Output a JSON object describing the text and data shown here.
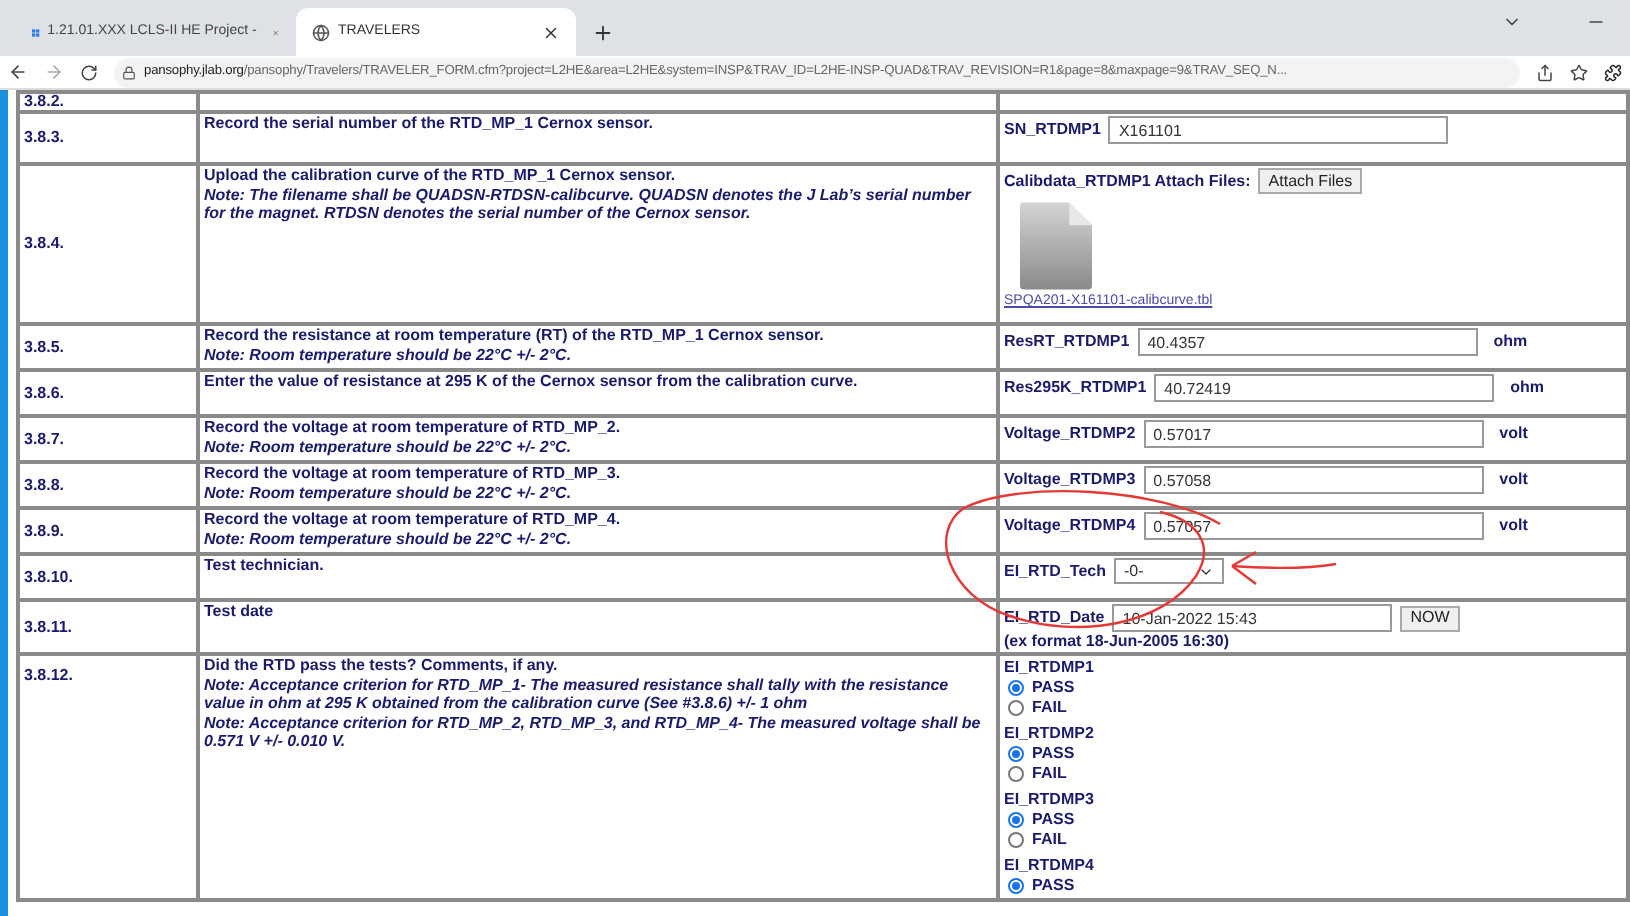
{
  "browser": {
    "tabs": [
      {
        "title": "1.21.01.XXX LCLS-II HE Project -",
        "selected": false
      },
      {
        "title": "TRAVELERS",
        "selected": true
      }
    ],
    "url": {
      "host": "pansophy.jlab.org",
      "path": "/pansophy/Travelers/TRAVELER_FORM.cfm?project=L2HE&area=L2HE&system=INSP&TRAV_ID=L2HE-INSP-QUAD&TRAV_REVISION=R1&page=8&maxpage=9&TRAV_SEQ_N..."
    }
  },
  "rows": [
    {
      "number": "3.8.2.",
      "instruction": [],
      "field": {
        "kind": "none"
      }
    },
    {
      "number": "3.8.3.",
      "instruction": [
        {
          "kind": "plain",
          "text": "Record the serial number of the RTD_MP_1 Cernox sensor."
        }
      ],
      "field": {
        "kind": "text",
        "label": "SN_RTDMP1",
        "value": "X161101"
      }
    },
    {
      "number": "3.8.4.",
      "instruction": [
        {
          "kind": "plain",
          "text": "Upload the calibration curve of the RTD_MP_1 Cernox sensor."
        },
        {
          "kind": "note",
          "text": "Note: The filename shall be QUADSN-RTDSN-calibcurve. QUADSN denotes the J Lab’s serial number for the magnet. RTDSN denotes the serial number of the Cernox sensor."
        }
      ],
      "field": {
        "kind": "attach",
        "label": "Calibdata_RTDMP1 Attach Files:",
        "button": "Attach Files",
        "filename": "SPQA201-X161101-calibcurve.tbl"
      }
    },
    {
      "number": "3.8.5.",
      "instruction": [
        {
          "kind": "plain",
          "text": "Record the resistance at room temperature (RT) of the RTD_MP_1 Cernox sensor."
        },
        {
          "kind": "note",
          "text": "Note: Room temperature should be 22°C +/- 2°C."
        }
      ],
      "field": {
        "kind": "text",
        "label": "ResRT_RTDMP1",
        "value": "40.4357",
        "unit": "ohm"
      }
    },
    {
      "number": "3.8.6.",
      "instruction": [
        {
          "kind": "plain",
          "text": "Enter the value of resistance at 295 K of the Cernox sensor from the calibration curve."
        }
      ],
      "field": {
        "kind": "text",
        "label": "Res295K_RTDMP1",
        "value": "40.72419",
        "unit": "ohm"
      }
    },
    {
      "number": "3.8.7.",
      "instruction": [
        {
          "kind": "plain",
          "text": "Record the voltage at room temperature of RTD_MP_2."
        },
        {
          "kind": "note",
          "text": "Note: Room temperature should be 22°C +/- 2°C."
        }
      ],
      "field": {
        "kind": "text",
        "label": "Voltage_RTDMP2",
        "value": "0.57017",
        "unit": "volt"
      }
    },
    {
      "number": "3.8.8.",
      "instruction": [
        {
          "kind": "plain",
          "text": "Record the voltage at room temperature of RTD_MP_3."
        },
        {
          "kind": "note",
          "text": "Note: Room temperature should be 22°C +/- 2°C."
        }
      ],
      "field": {
        "kind": "text",
        "label": "Voltage_RTDMP3",
        "value": "0.57058",
        "unit": "volt"
      }
    },
    {
      "number": "3.8.9.",
      "instruction": [
        {
          "kind": "plain",
          "text": "Record the voltage at room temperature of RTD_MP_4."
        },
        {
          "kind": "note",
          "text": "Note: Room temperature should be 22°C +/- 2°C."
        }
      ],
      "field": {
        "kind": "text",
        "label": "Voltage_RTDMP4",
        "value": "0.57057",
        "unit": "volt"
      }
    },
    {
      "number": "3.8.10.",
      "instruction": [
        {
          "kind": "plain",
          "text": "Test technician."
        }
      ],
      "field": {
        "kind": "select",
        "label": "EI_RTD_Tech",
        "value": "-0-"
      }
    },
    {
      "number": "3.8.11.",
      "instruction": [
        {
          "kind": "plain",
          "text": "Test date"
        }
      ],
      "field": {
        "kind": "datetime",
        "label": "EI_RTD_Date",
        "value": "10-Jan-2022 15:43",
        "button": "NOW",
        "hint": "(ex format 18-Jun-2005 16:30)"
      }
    },
    {
      "number": "3.8.12.",
      "instruction": [
        {
          "kind": "plain",
          "text": "Did the RTD pass the tests? Comments, if any."
        },
        {
          "kind": "note",
          "text": "Note: Acceptance criterion for RTD_MP_1- The measured resistance shall tally with the resistance value in ohm at 295 K obtained from the calibration curve (See #3.8.6) +/- 1 ohm"
        },
        {
          "kind": "note",
          "text": "Note: Acceptance criterion for RTD_MP_2, RTD_MP_3, and RTD_MP_4- The measured voltage shall be 0.571 V +/- 0.010 V."
        }
      ],
      "field": {
        "kind": "radios",
        "groups": [
          {
            "label": "EI_RTDMP1",
            "options": [
              {
                "label": "PASS",
                "selected": true
              },
              {
                "label": "FAIL",
                "selected": false
              }
            ]
          },
          {
            "label": "EI_RTDMP2",
            "options": [
              {
                "label": "PASS",
                "selected": true
              },
              {
                "label": "FAIL",
                "selected": false
              }
            ]
          },
          {
            "label": "EI_RTDMP3",
            "options": [
              {
                "label": "PASS",
                "selected": true
              },
              {
                "label": "FAIL",
                "selected": false
              }
            ]
          },
          {
            "label": "EI_RTDMP4",
            "options": [
              {
                "label": "PASS",
                "selected": true
              }
            ]
          }
        ]
      }
    }
  ]
}
